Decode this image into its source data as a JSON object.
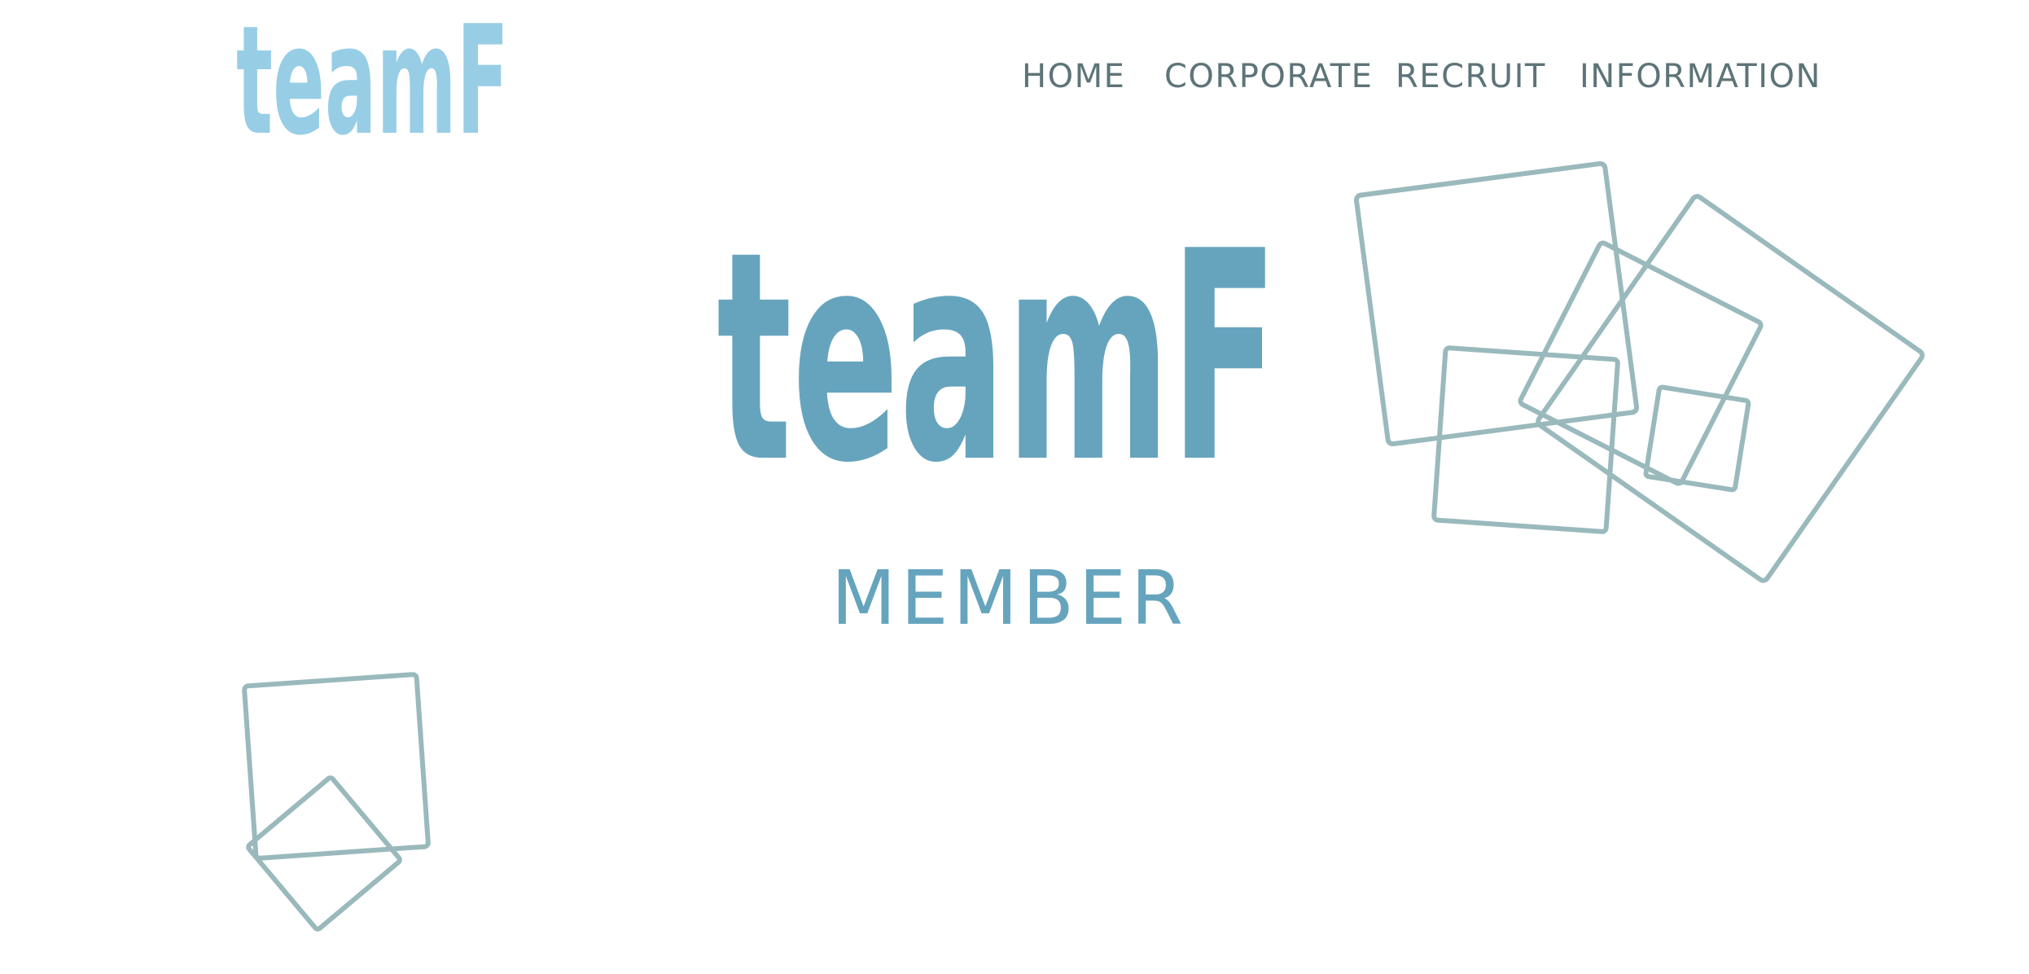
{
  "header": {
    "logo_text": "teamF",
    "logo_color": "#97cee6"
  },
  "nav": {
    "items": [
      {
        "label": "HOME",
        "name": "nav-home"
      },
      {
        "label": "CORPORATE",
        "name": "nav-corporate"
      },
      {
        "label": "RECRUIT",
        "name": "nav-recruit"
      },
      {
        "label": "INFORMATION",
        "name": "nav-information"
      }
    ],
    "color": "#5d7478"
  },
  "hero": {
    "logo_text": "teamF",
    "heading": "MEMBER",
    "color": "#66a4bd"
  },
  "decoration": {
    "stroke_color": "#9ab9bc",
    "shape": "outlined-squares"
  }
}
